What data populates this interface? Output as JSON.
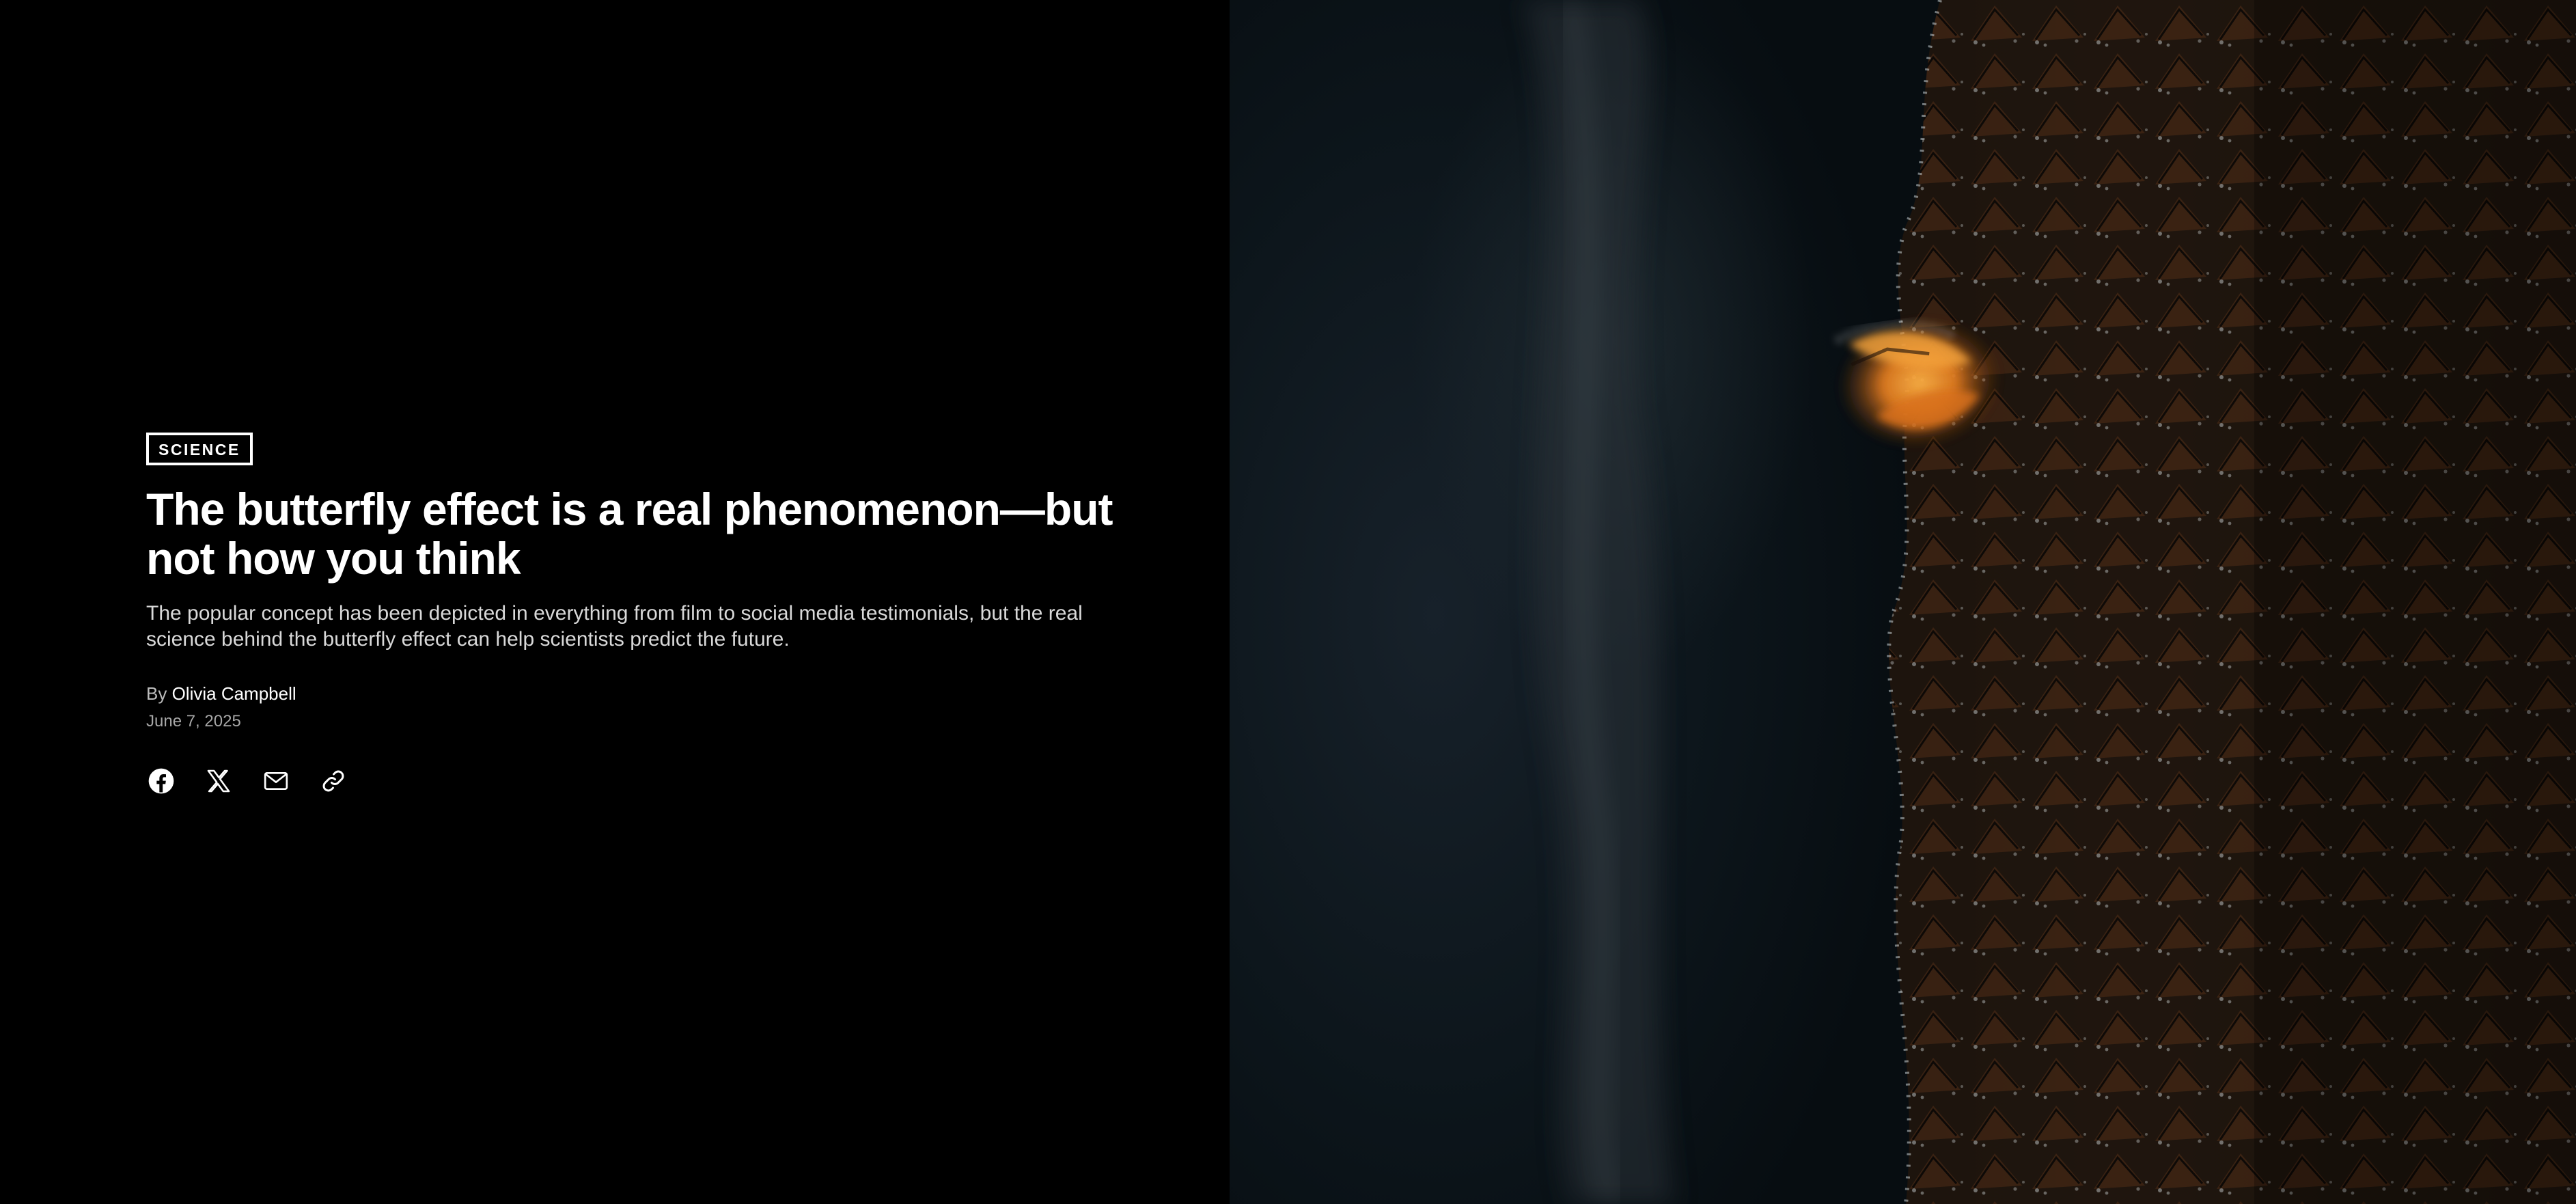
{
  "article": {
    "category": "SCIENCE",
    "title": "The butterfly effect is a real phenomenon—but not how you think",
    "dek": "The popular concept has been depicted in everything from film to social media testimonials, but the real science behind the butterfly effect can help scientists predict the future.",
    "byline_prefix": "By",
    "author": "Olivia Campbell",
    "date": "June 7, 2025"
  },
  "share": {
    "icons": [
      "facebook-icon",
      "x-icon",
      "email-icon",
      "link-icon"
    ]
  },
  "colors": {
    "background": "#000000",
    "text": "#ffffff",
    "dek": "#d9d9d9",
    "meta": "#a6a6a6",
    "butterfly_accent": "#e07a1f"
  }
}
